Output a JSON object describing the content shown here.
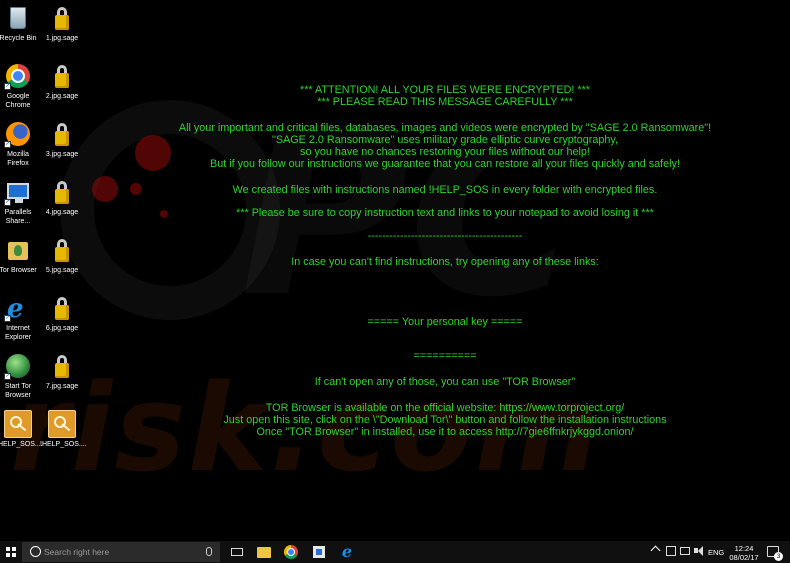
{
  "desktop": {
    "watermark": {
      "text": "risk.com"
    },
    "icons_left": [
      {
        "label": "Recycle Bin",
        "icon": "recycle-bin-icon"
      },
      {
        "label": "Google Chrome",
        "icon": "chrome-icon"
      },
      {
        "label": "Mozilla Firefox",
        "icon": "firefox-icon"
      },
      {
        "label": "Parallels Share...",
        "icon": "parallels-icon"
      },
      {
        "label": "Tor Browser",
        "icon": "tor-folder-icon"
      },
      {
        "label": "Internet Explorer",
        "icon": "internet-explorer-icon"
      },
      {
        "label": "Start Tor Browser",
        "icon": "globe-icon"
      },
      {
        "label": "!HELP_SOS....",
        "icon": "key-file-icon"
      }
    ],
    "icons_right": [
      {
        "label": "1.jpg.sage",
        "icon": "lock-icon"
      },
      {
        "label": "2.jpg.sage",
        "icon": "lock-icon"
      },
      {
        "label": "3.jpg.sage",
        "icon": "lock-icon"
      },
      {
        "label": "4.jpg.sage",
        "icon": "lock-icon"
      },
      {
        "label": "5.jpg.sage",
        "icon": "lock-icon"
      },
      {
        "label": "6.jpg.sage",
        "icon": "lock-icon"
      },
      {
        "label": "7.jpg.sage",
        "icon": "lock-icon"
      },
      {
        "label": "!HELP_SOS....",
        "icon": "key-file-icon"
      }
    ]
  },
  "message": {
    "attention": "*** ATTENTION! ALL YOUR FILES WERE ENCRYPTED! ***",
    "please_read": "*** PLEASE READ THIS MESSAGE CAREFULLY ***",
    "line1": "All your important and critical files, databases, images and videos were encrypted by \"SAGE 2.0 Ransomware\"!",
    "line2": "\"SAGE 2.0 Ransomware\" uses military grade elliptic curve cryptography,",
    "line3": "so you have no chances restoring your files without our help!",
    "line4": "But if you follow our instructions we guarantee that you can restore all your files quickly and safely!",
    "line5": "We created files with instructions named !HELP_SOS in every folder with encrypted files.",
    "line6": "*** Please be sure to copy instruction text and links to your notepad to avoid losing it ***",
    "divider1": "-------------------------------------------",
    "line7": "In case you can't find instructions, try opening any of these links:",
    "personal_key": "===== Your personal key =====",
    "divider2": "==========",
    "line8": "If can't open any of those, you can use \"TOR Browser\"",
    "line9": "TOR Browser is available on the official website: https://www.torproject.org/",
    "line10": "Just open this site, click on the \\\"Download Tor\\\" button and follow the installation instructions",
    "line11": "Once \"TOR Browser\" in installed, use it to access http://7gie6ffnkrjykggd.onion/"
  },
  "taskbar": {
    "search_placeholder": "Search right here",
    "language": "ENG",
    "time": "12:24",
    "date": "08/02/17",
    "notification_count": "3"
  },
  "colors": {
    "message_text": "#2fd22f",
    "desktop_bg": "#000000",
    "taskbar_bg": "#101010"
  }
}
